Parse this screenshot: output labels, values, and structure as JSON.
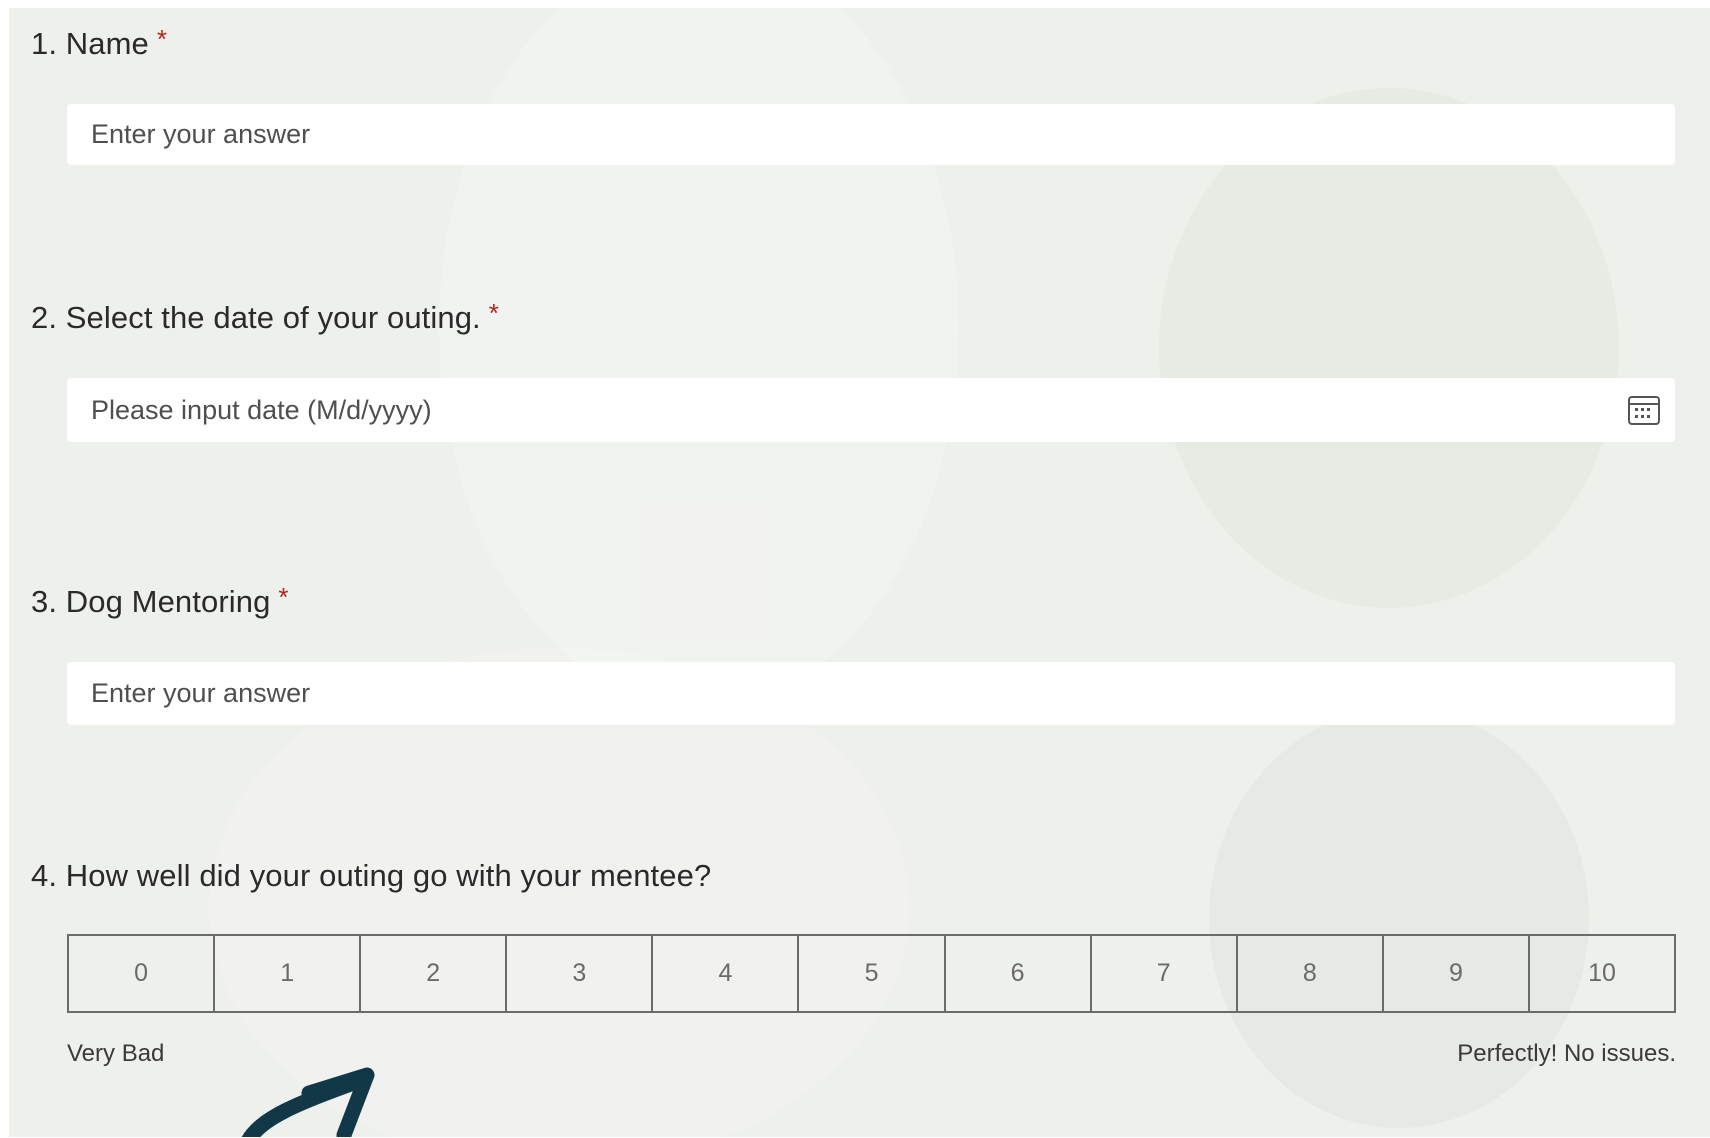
{
  "questions": [
    {
      "number": "1.",
      "title": "Name",
      "required_mark": "*",
      "placeholder": "Enter your answer"
    },
    {
      "number": "2.",
      "title": "Select the date of your outing.",
      "required_mark": "*",
      "placeholder": "Please input date (M/d/yyyy)"
    },
    {
      "number": "3.",
      "title": "Dog Mentoring",
      "required_mark": "*",
      "placeholder": "Enter your answer"
    },
    {
      "number": "4.",
      "title": "How well did your outing go with your mentee?"
    }
  ],
  "rating": {
    "options": [
      "0",
      "1",
      "2",
      "3",
      "4",
      "5",
      "6",
      "7",
      "8",
      "9",
      "10"
    ],
    "low_label": "Very Bad",
    "high_label": "Perfectly! No issues."
  },
  "icons": {
    "date_picker": "calendar-icon",
    "annotation": "arrow-icon"
  },
  "colors": {
    "required": "#b3261e",
    "background": "#eef0ec",
    "arrow": "#123746"
  }
}
